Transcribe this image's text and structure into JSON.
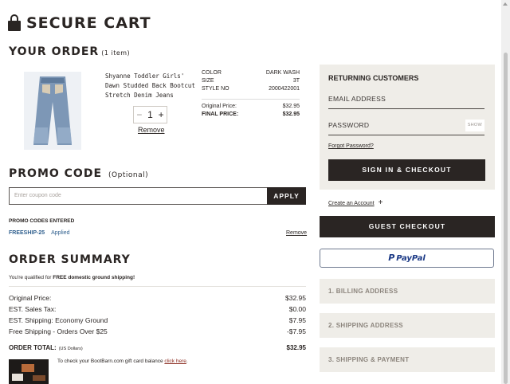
{
  "header": {
    "title": "SECURE CART"
  },
  "order": {
    "title": "YOUR ORDER",
    "count": "(1 item)"
  },
  "product": {
    "name": "Shyanne Toddler Girls' Dawn Studded Back Bootcut Stretch Denim Jeans",
    "quantity": "1",
    "remove_label": "Remove",
    "color_label": "COLOR",
    "color_value": "DARK WASH",
    "size_label": "SIZE",
    "size_value": "3T",
    "style_label": "STYLE NO",
    "style_value": "2000422001",
    "original_label": "Original Price:",
    "original_value": "$32.95",
    "final_label": "FINAL PRICE:",
    "final_value": "$32.95"
  },
  "promo": {
    "title": "PROMO CODE",
    "optional": "(Optional)",
    "placeholder": "Enter coupon code",
    "apply_label": "APPLY",
    "entered_label": "PROMO CODES ENTERED",
    "code": "FREESHIP-25",
    "status": "Applied",
    "remove_label": "Remove"
  },
  "summary": {
    "title": "ORDER SUMMARY",
    "note_prefix": "You're qualified for ",
    "note_bold": "FREE domestic ground shipping!",
    "rows": [
      {
        "label": "Original Price:",
        "value": "$32.95"
      },
      {
        "label": "EST. Sales Tax:",
        "value": "$0.00"
      },
      {
        "label": "EST. Shipping: Economy Ground",
        "value": "$7.95"
      },
      {
        "label": "Free Shipping - Orders Over $25",
        "value": "-$7.95"
      }
    ],
    "total_label": "ORDER TOTAL:",
    "total_currency": "(US Dollars)",
    "total_value": "$32.95",
    "gift_text": "To check your BootBarn.com gift card balance ",
    "gift_link": "click here",
    "gift_end": "."
  },
  "returning": {
    "title": "RETURNING CUSTOMERS",
    "email_label": "EMAIL ADDRESS",
    "password_label": "PASSWORD",
    "show_label": "SHOW",
    "forgot_label": "Forgot Password?",
    "signin_label": "SIGN IN & CHECKOUT"
  },
  "create_account": "Create an Account",
  "guest_label": "GUEST CHECKOUT",
  "paypal_label": "PayPal",
  "steps": [
    "1. BILLING ADDRESS",
    "2. SHIPPING ADDRESS",
    "3. SHIPPING & PAYMENT"
  ],
  "colors": {
    "dark": "#2a2523",
    "panel": "#efede8",
    "link_blue": "#2f5f8e",
    "paypal_blue": "#1c3a86"
  }
}
